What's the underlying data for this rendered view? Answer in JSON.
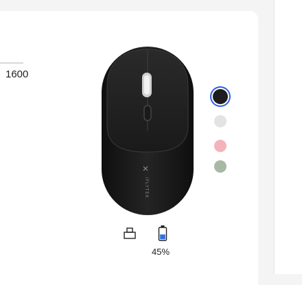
{
  "dpi": {
    "value": "1600"
  },
  "product": {
    "brand_mark": "iFLYTEK"
  },
  "colors": {
    "options": [
      {
        "name": "black",
        "hex": "#1e1e1e",
        "selected": true
      },
      {
        "name": "light-gray",
        "hex": "#e3e3e3",
        "selected": false
      },
      {
        "name": "pink",
        "hex": "#f4b3ba",
        "selected": false
      },
      {
        "name": "sage-green",
        "hex": "#a7b8a4",
        "selected": false
      }
    ],
    "selection_ring": "#2f5ee6"
  },
  "status": {
    "receiver_icon": "usb-receiver-icon",
    "battery_icon": "battery-icon",
    "battery_level": 0.45,
    "battery_text": "45%",
    "battery_fill_color": "#2f6fe0"
  }
}
